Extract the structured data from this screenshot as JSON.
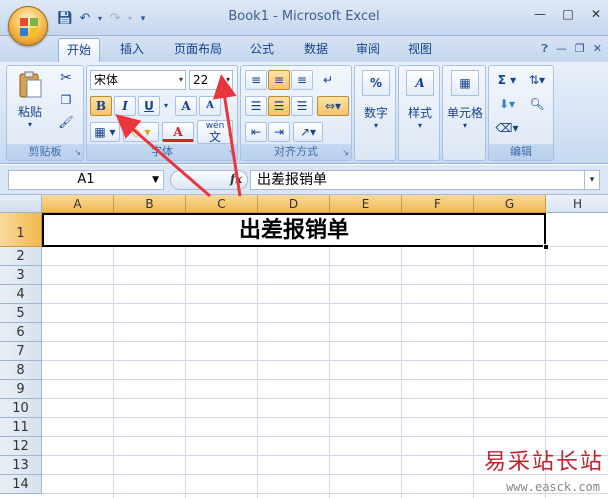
{
  "window": {
    "title": "Book1 - Microsoft Excel",
    "controls": [
      "minimize",
      "maximize",
      "close"
    ]
  },
  "quick_access": {
    "icons": [
      "save-icon",
      "undo-icon",
      "redo-icon",
      "customize-icon"
    ]
  },
  "tabs": [
    {
      "label": "开始",
      "active": true
    },
    {
      "label": "插入"
    },
    {
      "label": "页面布局"
    },
    {
      "label": "公式"
    },
    {
      "label": "数据"
    },
    {
      "label": "审阅"
    },
    {
      "label": "视图"
    }
  ],
  "ribbon": {
    "clipboard": {
      "paste_label": "粘贴",
      "group_label": "剪贴板"
    },
    "font": {
      "font_name": "宋体",
      "font_size": "22",
      "bold": "B",
      "italic": "I",
      "underline": "U",
      "grow": "A",
      "shrink": "A",
      "font_color": "A",
      "phonetic": "wén",
      "phonetic_char": "文",
      "group_label": "字体"
    },
    "alignment": {
      "group_label": "对齐方式"
    },
    "number": {
      "label": "数字",
      "symbol": "%"
    },
    "styles": {
      "label": "样式"
    },
    "cells": {
      "label": "单元格"
    },
    "editing": {
      "group_label": "编辑",
      "sum_symbol": "Σ"
    }
  },
  "formula_bar": {
    "name_box": "A1",
    "fx": "fx",
    "content": "出差报销单"
  },
  "sheet": {
    "columns": [
      "A",
      "B",
      "C",
      "D",
      "E",
      "F",
      "G",
      "H"
    ],
    "rows": [
      "1",
      "2",
      "3",
      "4",
      "5",
      "6",
      "7",
      "8",
      "9",
      "10",
      "11",
      "12",
      "13",
      "14"
    ],
    "merged_cell_text": "出差报销单",
    "selected_cell": "A1"
  },
  "watermark": {
    "text": "易采站长站",
    "url": "www.easck.com"
  },
  "colors": {
    "ribbon_bg": "#d3e1f3",
    "selected_header": "#f1b94c",
    "arrow": "#e8363c",
    "accent": "#15428b"
  }
}
